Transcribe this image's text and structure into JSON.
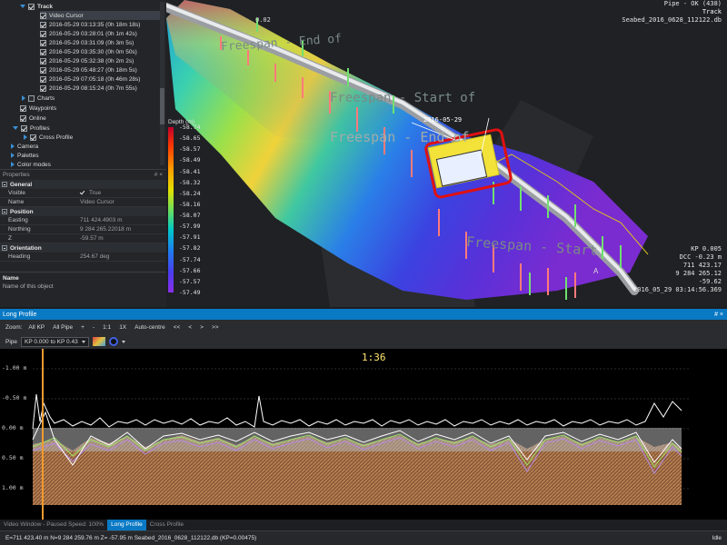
{
  "tree": {
    "items": [
      {
        "label": "Track",
        "checked": true,
        "bold": true
      },
      {
        "label": "Video Cursor",
        "checked": true
      },
      {
        "label": "2016-05-29 03:13:35 (0h 18m 18s)",
        "checked": true
      },
      {
        "label": "2016-05-29 03:28:01 (0h 1m 42s)",
        "checked": true
      },
      {
        "label": "2016-05-29 03:31:09 (0h 3m 5s)",
        "checked": true
      },
      {
        "label": "2016-05-29 03:35:30 (0h 0m 50s)",
        "checked": true
      },
      {
        "label": "2016-05-29 05:32:38 (0h 2m 2s)",
        "checked": true
      },
      {
        "label": "2016-05-29 05:48:27 (0h 18m 5s)",
        "checked": true
      },
      {
        "label": "2016-05-29 07:05:18 (0h 46m 28s)",
        "checked": true
      },
      {
        "label": "2016-05-29 08:15:24 (0h 7m 55s)",
        "checked": true
      },
      {
        "label": "Charts",
        "checked": false
      },
      {
        "label": "Waypoints",
        "checked": true
      },
      {
        "label": "Online",
        "checked": true
      },
      {
        "label": "Profiles",
        "checked": true
      },
      {
        "label": "Cross Profile",
        "checked": true
      },
      {
        "label": "Camera"
      },
      {
        "label": "Palettes"
      },
      {
        "label": "Color modes"
      }
    ]
  },
  "properties": {
    "header": "Properties",
    "header_pin": "# ×",
    "groups": {
      "general": "General",
      "position": "Position",
      "orientation": "Orientation"
    },
    "rows": {
      "visible_k": "Visible",
      "visible_v": "True",
      "name_k": "Name",
      "name_v": "Video Cursor",
      "easting_k": "Easting",
      "easting_v": "711 424.4903 m",
      "northing_k": "Northing",
      "northing_v": "9 284 265.22018 m",
      "z_k": "Z",
      "z_v": "-59.57 m",
      "heading_k": "Heading",
      "heading_v": "254.67 deg"
    },
    "desc_title": "Name",
    "desc_text": "Name of this object"
  },
  "viewport": {
    "hud_right": [
      "Pipe - OK (438)",
      "Track",
      "Seabed_2016_0628_112122.db"
    ],
    "hud_bottom_right": [
      "KP 0.005",
      "DCC -0.23 m",
      "711 423.17",
      "9 284 265.12",
      "-59.62",
      "2016_05_29 03:14:56.369"
    ],
    "labels": {
      "start_top": "Freespan - Start of",
      "end_top": "Freespan - End of",
      "start_mid": "Freespan - Start of",
      "end_mid": "Freespan - End of",
      "start_bottom": "Freespan - Start",
      "date": "2016-05-29",
      "small_a": "0.02",
      "small_b": "A"
    },
    "legend": {
      "title": "Depth (m)",
      "values": [
        "-58.74",
        "-58.65",
        "-58.57",
        "-58.49",
        "-58.41",
        "-58.32",
        "-58.24",
        "-58.16",
        "-58.07",
        "-57.99",
        "-57.91",
        "-57.82",
        "-57.74",
        "-57.66",
        "-57.57",
        "-57.49"
      ],
      "colors": [
        "#c2002a",
        "#ff3c00",
        "#ff9a00",
        "#e4e000",
        "#6de05a",
        "#00c8c8",
        "#1e7cf0",
        "#4b3cf0",
        "#8a2ee8"
      ]
    }
  },
  "long_profile": {
    "title": "Long Profile",
    "title_icons": "# ×",
    "toolbar": {
      "zoom_label": "Zoom:",
      "all_kp": "All KP",
      "all_pipe": "All Pipe",
      "minus": "-",
      "one_to_one": "1:1",
      "one_x": "1X",
      "auto_centre": "Auto-centre",
      "nav_first": "<<",
      "nav_prev": "<",
      "nav_next": ">",
      "nav_last": ">>",
      "pipe_label": "Pipe",
      "pipe_range": "KP 0.000 to KP 0.43"
    },
    "timer": "1:36",
    "y_ticks": [
      "-1.00 m",
      "-0.50 m",
      "0.00 m",
      "0.50 m",
      "1.00 m"
    ]
  },
  "tabs": [
    {
      "label": "Video Window - Paused Speed: 100%",
      "active": false
    },
    {
      "label": "Long Profile",
      "active": true
    },
    {
      "label": "Cross Profile",
      "active": false
    }
  ],
  "status": {
    "left": "E=711 423.40 m N=9 284 259.76 m Z= -57.95 m Seabed_2016_0628_112122.db (KP=0.00475)",
    "right": "Idle"
  },
  "colors": {
    "accent": "#0a79c4",
    "pipe_ok": "#f2f2f2",
    "seabed_profile": "#c8905a",
    "freespan_label": "#7a8a86"
  }
}
